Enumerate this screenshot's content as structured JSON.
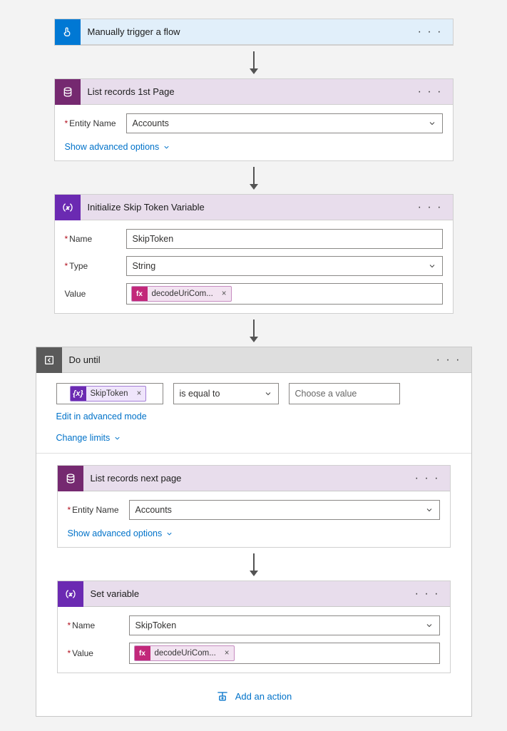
{
  "trigger": {
    "title": "Manually trigger a flow"
  },
  "listRecords1": {
    "title": "List records 1st Page",
    "entityLabel": "Entity Name",
    "entityValue": "Accounts",
    "advanced": "Show advanced options"
  },
  "initVar": {
    "title": "Initialize Skip Token Variable",
    "nameLabel": "Name",
    "nameValue": "SkipToken",
    "typeLabel": "Type",
    "typeValue": "String",
    "valueLabel": "Value",
    "expressionToken": "decodeUriCom..."
  },
  "doUntil": {
    "title": "Do until",
    "conditionVarToken": "SkipToken",
    "operator": "is equal to",
    "valuePlaceholder": "Choose a value",
    "editAdvanced": "Edit in advanced mode",
    "changeLimits": "Change limits"
  },
  "listRecordsNext": {
    "title": "List records next page",
    "entityLabel": "Entity Name",
    "entityValue": "Accounts",
    "advanced": "Show advanced options"
  },
  "setVar": {
    "title": "Set variable",
    "nameLabel": "Name",
    "nameValue": "SkipToken",
    "valueLabel": "Value",
    "expressionToken": "decodeUriCom..."
  },
  "addActionLabel": "Add an action"
}
